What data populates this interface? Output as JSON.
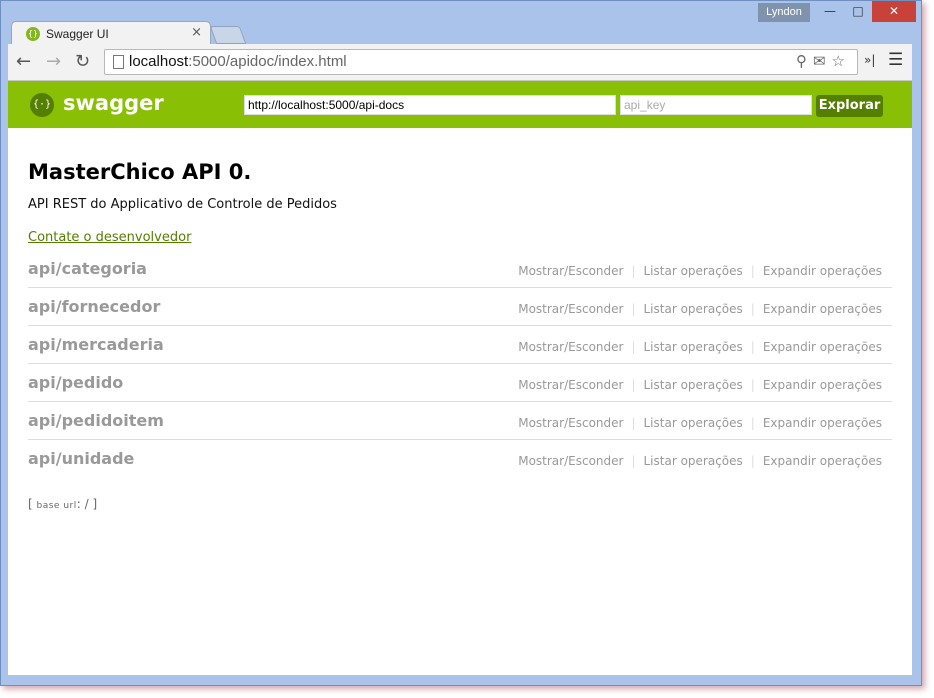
{
  "browser": {
    "tab_title": "Swagger UI",
    "tab_close": "×",
    "user_name": "Lyndon",
    "url_host": "localhost",
    "url_rest": ":5000/apidoc/index.html"
  },
  "header": {
    "brand": "swagger",
    "logo_glyph": "{·}",
    "spec_url": "http://localhost:5000/api-docs",
    "api_key_placeholder": "api_key",
    "explore_label": "Explorar",
    "accent_color": "#89bf04",
    "dark_accent_color": "#547f00"
  },
  "info": {
    "title": "MasterChico API 0.",
    "description": "API REST do Applicativo de Controle de Pedidos",
    "contact_label": "Contate o desenvolvedor"
  },
  "resources": [
    {
      "name": "api/categoria",
      "show_hide": "Mostrar/Esconder",
      "list_ops": "Listar operações",
      "expand_ops": "Expandir operações"
    },
    {
      "name": "api/fornecedor",
      "show_hide": "Mostrar/Esconder",
      "list_ops": "Listar operações",
      "expand_ops": "Expandir operações"
    },
    {
      "name": "api/mercaderia",
      "show_hide": "Mostrar/Esconder",
      "list_ops": "Listar operações",
      "expand_ops": "Expandir operações"
    },
    {
      "name": "api/pedido",
      "show_hide": "Mostrar/Esconder",
      "list_ops": "Listar operações",
      "expand_ops": "Expandir operações"
    },
    {
      "name": "api/pedidoitem",
      "show_hide": "Mostrar/Esconder",
      "list_ops": "Listar operações",
      "expand_ops": "Expandir operações"
    },
    {
      "name": "api/unidade",
      "show_hide": "Mostrar/Esconder",
      "list_ops": "Listar operações",
      "expand_ops": "Expandir operações"
    }
  ],
  "footer": {
    "base_url_label": "base url",
    "base_url_value": "/"
  }
}
